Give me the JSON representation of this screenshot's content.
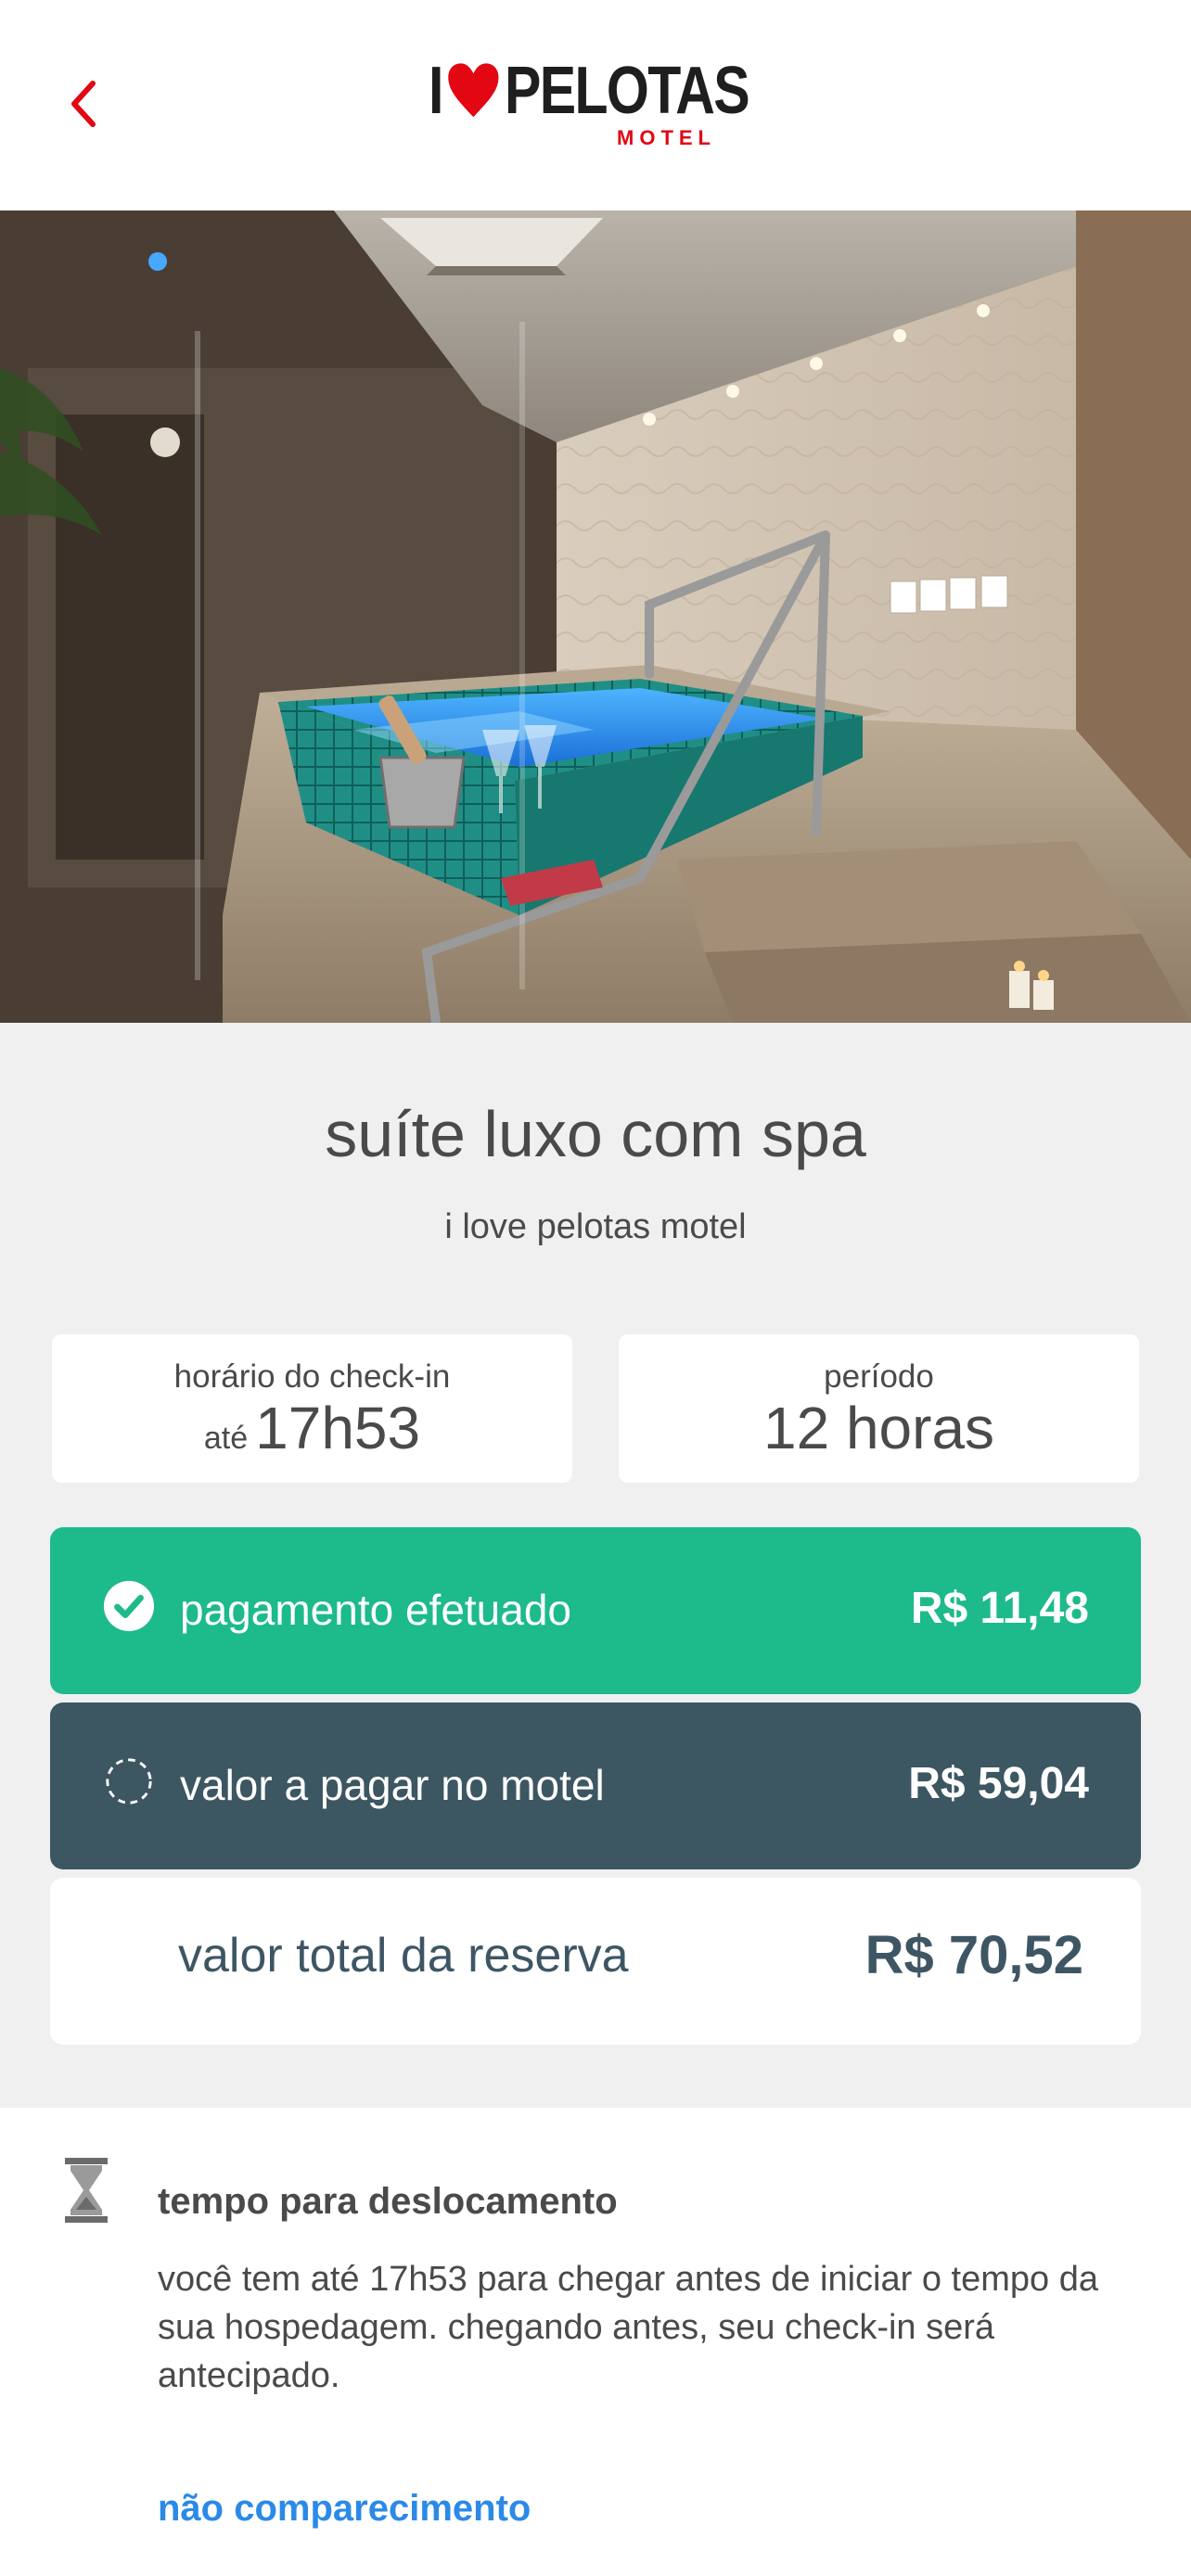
{
  "header": {
    "logo_text": "I ❤ PELOTAS",
    "logo_main_left": "I",
    "logo_main_right": "PELOTAS",
    "logo_sub": "MOTEL",
    "back_icon": "chevron-left-icon",
    "accent_color": "#e30613"
  },
  "hero": {
    "image_subject": "suite with spa pool"
  },
  "room": {
    "title": "suíte luxo com spa",
    "motel_name": "i love pelotas motel"
  },
  "checkin": {
    "label": "horário do check-in",
    "prefix": "até",
    "time": "17h53"
  },
  "period": {
    "label": "período",
    "value": "12 horas"
  },
  "payments": {
    "paid": {
      "icon": "check-circle-icon",
      "label": "pagamento efetuado",
      "amount": "R$ 11,48",
      "color": "#1dba8c"
    },
    "due": {
      "icon": "dashed-circle-icon",
      "label": "valor a pagar no motel",
      "amount": "R$ 59,04",
      "color": "#3c5662"
    },
    "total": {
      "label": "valor total da reserva",
      "amount": "R$ 70,52"
    }
  },
  "travel": {
    "icon": "hourglass-icon",
    "title": "tempo para deslocamento",
    "text": "você tem até 17h53 para chegar antes de iniciar o tempo da sua hospedagem. chegando antes, seu check-in será antecipado."
  },
  "no_show": {
    "link_label": "não comparecimento",
    "color": "#2b8ae8"
  }
}
